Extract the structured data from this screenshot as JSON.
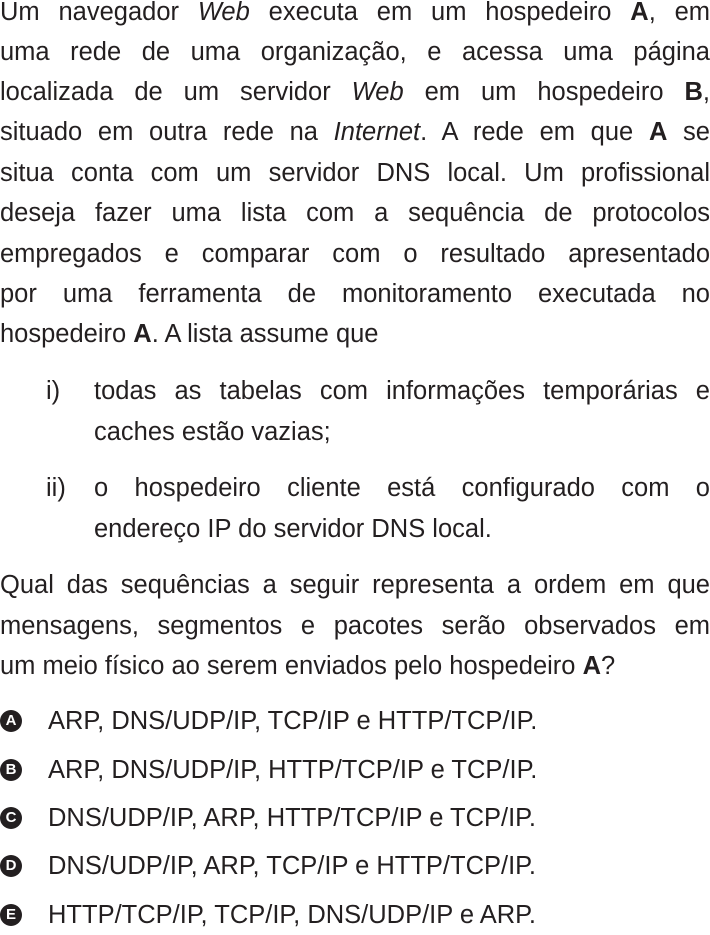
{
  "paragraph1": {
    "line1": {
      "a": "Um navegador ",
      "web": "Web",
      "b": " executa em um hospedeiro ",
      "bold": "A",
      "c": ", em"
    },
    "line2": "uma rede de uma organização, e acessa uma página",
    "line3": {
      "a": "localizada de um servidor ",
      "web": "Web",
      "b": " em um hospedeiro ",
      "bold": "B",
      "c": ","
    },
    "line4": {
      "a": "situado em outra rede na ",
      "internet": "Internet",
      "b": ". A rede em que ",
      "bold": "A",
      "c": " se"
    },
    "line5": "situa conta com um servidor DNS local. Um profissional",
    "line6": "deseja fazer uma lista com a sequência de protocolos",
    "line7": "empregados e comparar com o resultado apresentado",
    "line8": "por uma ferramenta de monitoramento executada no",
    "line9": {
      "a": "hospedeiro ",
      "bold": "A",
      "b": ". A lista assume que"
    }
  },
  "assumptions": [
    {
      "marker": "i)",
      "line1": "todas as tabelas com informações temporárias e",
      "line2": "caches estão vazias;"
    },
    {
      "marker": "ii)",
      "line1": "o hospedeiro cliente está configurado com o",
      "line2": "endereço IP do servidor DNS local."
    }
  ],
  "question": {
    "line1": "Qual das sequências a seguir representa a ordem em que",
    "line2": "mensagens, segmentos e pacotes serão observados em",
    "line3": {
      "a": "um meio físico ao serem enviados pelo hospedeiro ",
      "bold": "A",
      "b": "?"
    }
  },
  "options": [
    {
      "letter": "A",
      "text": "ARP, DNS/UDP/IP, TCP/IP e HTTP/TCP/IP."
    },
    {
      "letter": "B",
      "text": "ARP, DNS/UDP/IP, HTTP/TCP/IP e TCP/IP."
    },
    {
      "letter": "C",
      "text": "DNS/UDP/IP, ARP, HTTP/TCP/IP e TCP/IP."
    },
    {
      "letter": "D",
      "text": "DNS/UDP/IP, ARP, TCP/IP e HTTP/TCP/IP."
    },
    {
      "letter": "E",
      "text": "HTTP/TCP/IP, TCP/IP, DNS/UDP/IP e ARP."
    }
  ]
}
